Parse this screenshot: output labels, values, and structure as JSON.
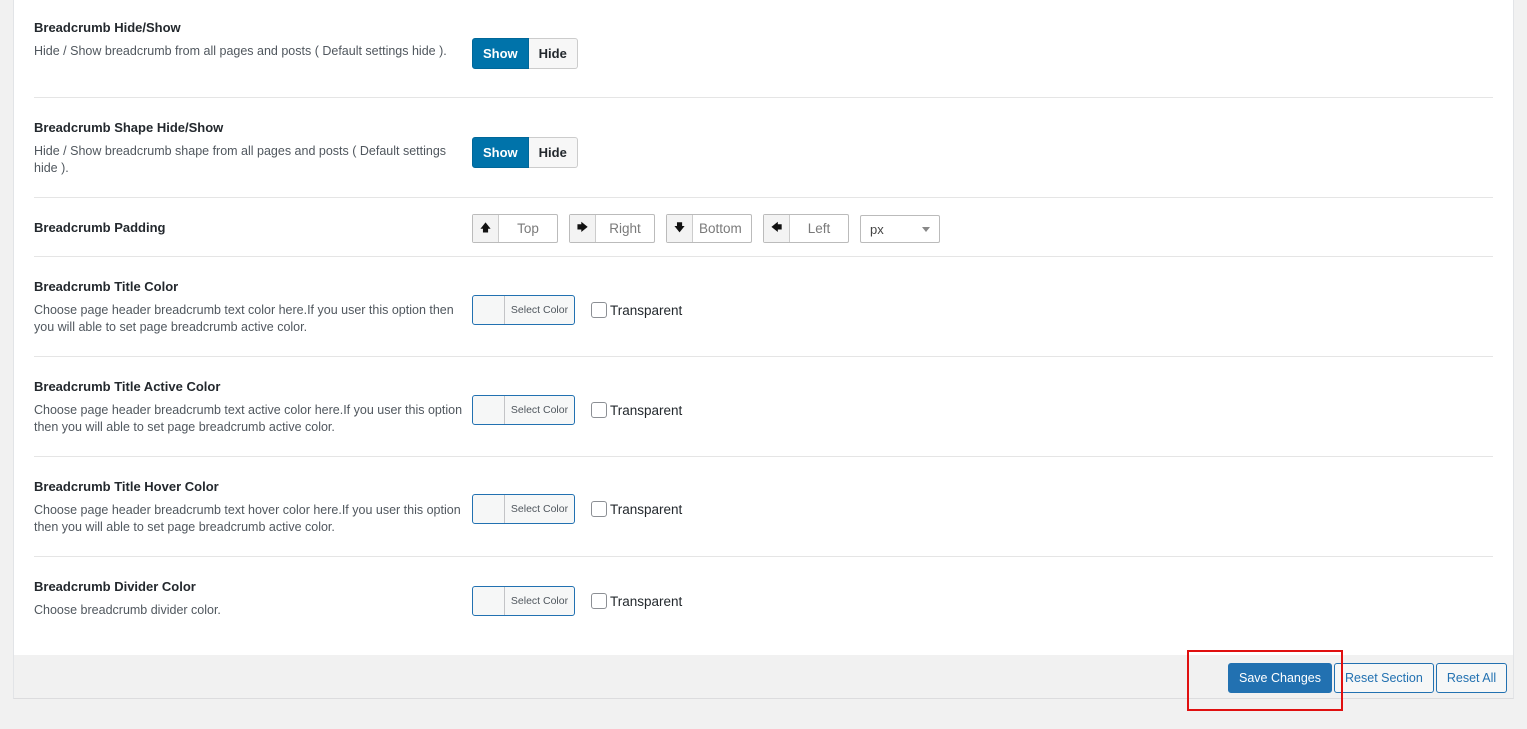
{
  "rows": {
    "breadcrumb_hide_show": {
      "title": "Breadcrumb Hide/Show",
      "desc": "Hide / Show breadcrumb from all pages and posts ( Default settings hide ).",
      "show": "Show",
      "hide": "Hide"
    },
    "breadcrumb_shape": {
      "title": "Breadcrumb Shape Hide/Show",
      "desc": "Hide / Show breadcrumb shape from all pages and posts ( Default settings hide ).",
      "show": "Show",
      "hide": "Hide"
    },
    "padding": {
      "title": "Breadcrumb Padding",
      "top": "Top",
      "right": "Right",
      "bottom": "Bottom",
      "left": "Left",
      "unit": "px"
    },
    "title_color": {
      "title": "Breadcrumb Title Color",
      "desc": "Choose page header breadcrumb text color here.If you user this option then you will able to set page breadcrumb active color.",
      "select": "Select Color",
      "transparent": "Transparent"
    },
    "title_active_color": {
      "title": "Breadcrumb Title Active Color",
      "desc": "Choose page header breadcrumb text active color here.If you user this option then you will able to set page breadcrumb active color.",
      "select": "Select Color",
      "transparent": "Transparent"
    },
    "title_hover_color": {
      "title": "Breadcrumb Title Hover Color",
      "desc": "Choose page header breadcrumb text hover color here.If you user this option then you will able to set page breadcrumb active color.",
      "select": "Select Color",
      "transparent": "Transparent"
    },
    "divider_color": {
      "title": "Breadcrumb Divider Color",
      "desc": "Choose breadcrumb divider color.",
      "select": "Select Color",
      "transparent": "Transparent"
    }
  },
  "actions": {
    "save": "Save Changes",
    "reset_section": "Reset Section",
    "reset_all": "Reset All"
  },
  "icons": {
    "top": "arrow-up-icon",
    "right": "arrow-right-icon",
    "bottom": "arrow-down-icon",
    "left": "arrow-left-icon"
  },
  "colors": {
    "accent": "#0073aa",
    "primary_button": "#2271b1",
    "highlight": "#e01010"
  }
}
